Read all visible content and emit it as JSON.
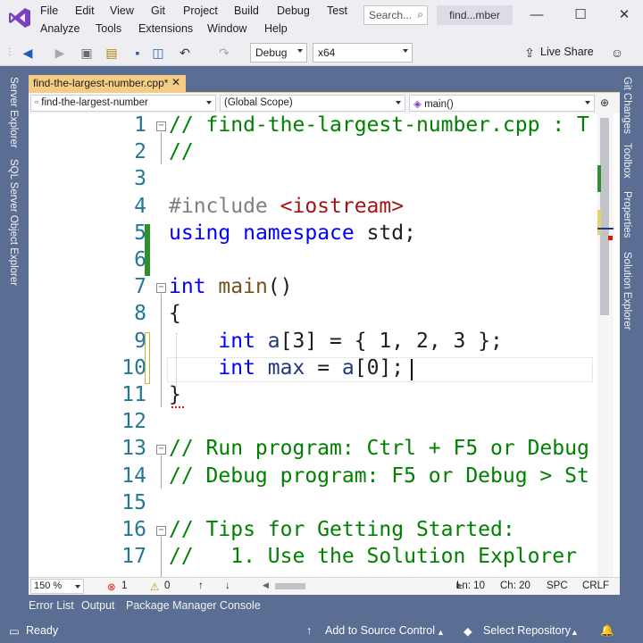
{
  "menu": {
    "row1": [
      "File",
      "Edit",
      "View",
      "Git",
      "Project",
      "Build",
      "Debug",
      "Test"
    ],
    "row2": [
      "Analyze",
      "Tools",
      "Extensions",
      "Window",
      "Help"
    ]
  },
  "search_placeholder": "Search...",
  "solution_name": "find...mber",
  "window_controls": {
    "minimize": "—",
    "maximize": "☐",
    "close": "✕"
  },
  "toolbar": {
    "config": "Debug",
    "platform": "x64",
    "live_share": "Live Share"
  },
  "left_tool_windows": [
    "Server Explorer",
    "SQL Server Object Explorer"
  ],
  "right_tool_windows": [
    "Git Changes",
    "Toolbox",
    "Properties",
    "Solution Explorer"
  ],
  "doc_tab": {
    "title": "find-the-largest-number.cpp*"
  },
  "navbar": {
    "project": "find-the-largest-number",
    "scope": "(Global Scope)",
    "member": "main()"
  },
  "code_lines": [
    {
      "n": "1",
      "parts": [
        [
          "cm",
          "// find-the-largest-number.cpp : T"
        ]
      ]
    },
    {
      "n": "2",
      "parts": [
        [
          "cm",
          "//"
        ]
      ]
    },
    {
      "n": "3",
      "parts": []
    },
    {
      "n": "4",
      "parts": [
        [
          "pp",
          "#include "
        ],
        [
          "str",
          "<iostream>"
        ]
      ]
    },
    {
      "n": "5",
      "parts": [
        [
          "kw",
          "using"
        ],
        [
          "",
          " "
        ],
        [
          "kw",
          "namespace"
        ],
        [
          "",
          " std;"
        ]
      ]
    },
    {
      "n": "6",
      "parts": []
    },
    {
      "n": "7",
      "parts": [
        [
          "kw",
          "int"
        ],
        [
          "",
          " "
        ],
        [
          "fn",
          "main"
        ],
        [
          "",
          "()"
        ]
      ]
    },
    {
      "n": "8",
      "parts": [
        [
          "",
          "{"
        ]
      ]
    },
    {
      "n": "9",
      "parts": [
        [
          "",
          "    "
        ],
        [
          "kw",
          "int"
        ],
        [
          "",
          " "
        ],
        [
          "var",
          "a"
        ],
        [
          "",
          "[3] = { 1, 2, 3 };"
        ]
      ]
    },
    {
      "n": "10",
      "parts": [
        [
          "",
          "    "
        ],
        [
          "kw",
          "int"
        ],
        [
          "",
          " "
        ],
        [
          "var",
          "max"
        ],
        [
          "",
          " = "
        ],
        [
          "var",
          "a"
        ],
        [
          "",
          "[0];"
        ]
      ]
    },
    {
      "n": "11",
      "parts": [
        [
          "",
          "}"
        ]
      ]
    },
    {
      "n": "12",
      "parts": []
    },
    {
      "n": "13",
      "parts": [
        [
          "cm",
          "// Run program: Ctrl + F5 or Debug"
        ]
      ]
    },
    {
      "n": "14",
      "parts": [
        [
          "cm",
          "// Debug program: F5 or Debug > St"
        ]
      ]
    },
    {
      "n": "15",
      "parts": []
    },
    {
      "n": "16",
      "parts": [
        [
          "cm",
          "// Tips for Getting Started:"
        ]
      ]
    },
    {
      "n": "17",
      "parts": [
        [
          "cm",
          "//   1. Use the Solution Explorer"
        ]
      ]
    }
  ],
  "editor_status": {
    "zoom": "150 %",
    "errors": "1",
    "warnings": "0",
    "line": "Ln: 10",
    "col": "Ch: 20",
    "whitespace": "SPC",
    "line_ending": "CRLF"
  },
  "bottom_tabs": [
    "Error List",
    "Output",
    "Package Manager Console"
  ],
  "statusbar": {
    "ready": "Ready",
    "add_source": "Add to Source Control",
    "select_repo": "Select Repository"
  },
  "colors": {
    "accent": "#5a6d93",
    "tab_active": "#f5cc84",
    "comment": "#008000",
    "keyword": "#0000ff",
    "line_number": "#237893"
  }
}
